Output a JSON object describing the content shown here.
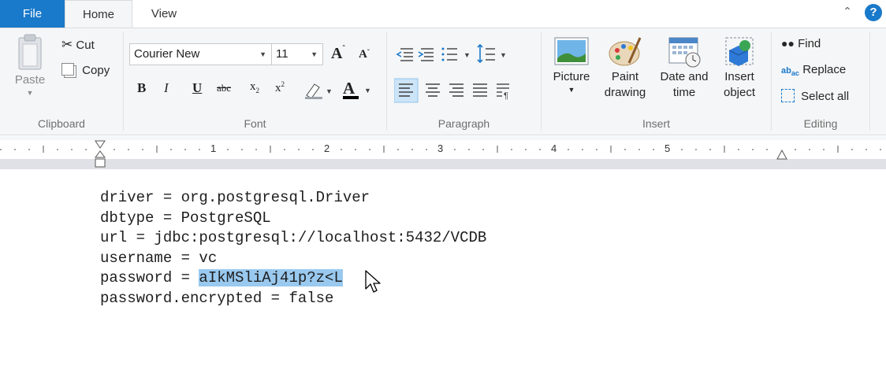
{
  "tabs": {
    "file": "File",
    "home": "Home",
    "view": "View"
  },
  "ribbon": {
    "clipboard": {
      "label": "Clipboard",
      "paste": "Paste",
      "cut": "Cut",
      "copy": "Copy"
    },
    "font": {
      "label": "Font",
      "family": "Courier New",
      "size": "11"
    },
    "paragraph": {
      "label": "Paragraph"
    },
    "insert": {
      "label": "Insert",
      "picture": "Picture",
      "paint1": "Paint",
      "paint2": "drawing",
      "date1": "Date and",
      "date2": "time",
      "obj1": "Insert",
      "obj2": "object"
    },
    "editing": {
      "label": "Editing",
      "find": "Find",
      "replace": "Replace",
      "select_all": "Select all"
    }
  },
  "ruler": {
    "numbers": [
      "1",
      "2",
      "3",
      "4",
      "5"
    ]
  },
  "document": {
    "lines": [
      "driver = org.postgresql.Driver",
      "dbtype = PostgreSQL",
      "url = jdbc:postgresql://localhost:5432/VCDB",
      "username = vc"
    ],
    "password_prefix": "password = ",
    "password_selected": "aIkMSliAj41p?z<L",
    "last_line": "password.encrypted = false"
  },
  "colors": {
    "accent": "#1979ca",
    "selection": "#99c9ef",
    "ribbon_bg": "#f5f6f7"
  }
}
